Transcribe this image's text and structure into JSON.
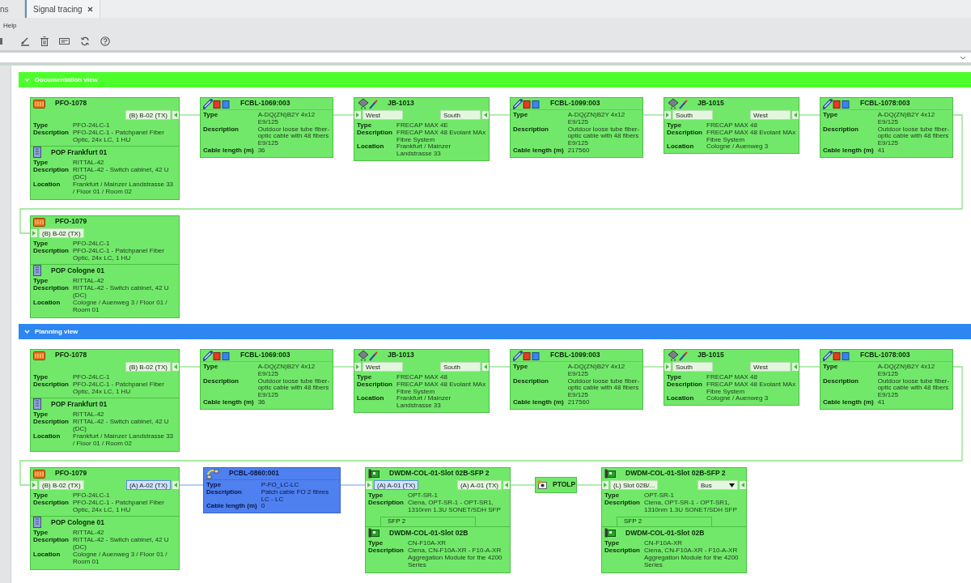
{
  "tabs": [
    {
      "label": "ns",
      "selected": false,
      "closable": false
    },
    {
      "label": "Signal tracing",
      "selected": true,
      "closable": true
    }
  ],
  "menu": [
    "Help"
  ],
  "sections": [
    {
      "title": "Documentation view",
      "color": "#4cff2c",
      "expanded": true,
      "rows": [
        [
          {
            "kind": "panel",
            "title": "PFO-1078",
            "selected": false,
            "ports": [
              {
                "label": "(B) B-02 (TX)",
                "kind": "output",
                "selected": false
              }
            ],
            "fields": [
              {
                "label": "Type",
                "value": "PFO-24LC-1"
              },
              {
                "label": "Description",
                "value": "PFO-24LC-1 - Patchpanel Fiber Optic, 24x LC, 1 HU"
              }
            ],
            "sub": {
              "kind": "cabinet",
              "title": "POP Frankfurt 01",
              "fields": [
                {
                  "label": "Type",
                  "value": "RITTAL-42"
                },
                {
                  "label": "Description",
                  "value": "RITTAL-42 - Switch cabinet, 42 U (DC)"
                },
                {
                  "label": "Location",
                  "value": "Frankfurt / Mainzer Landstrasse 33 / Floor 01 / Room 02"
                }
              ]
            }
          },
          {
            "kind": "cable",
            "title": "FCBL-1069:003",
            "selected": false,
            "fields": [
              {
                "label": "Type",
                "value": "A-DQ(ZN)B2Y 4x12 E9/125"
              },
              {
                "label": "Description",
                "value": "Outdoor loose tube fiber-optic cable with 48 fibers E9/125"
              },
              {
                "label": "Cable length (m)",
                "value": "36"
              }
            ]
          },
          {
            "kind": "junction",
            "title": "JB-1013",
            "selected": false,
            "ports": [
              {
                "label": "West",
                "kind": "input",
                "selected": false
              },
              {
                "label": "South",
                "kind": "output",
                "selected": false
              }
            ],
            "fields": [
              {
                "label": "Type",
                "value": "FRECAP MAX 4E"
              },
              {
                "label": "Description",
                "value": "FRECAP MAX 48 Evolant MAx Fibre System"
              },
              {
                "label": "Location",
                "value": "Frankfurt / Mainzer Landstrasse 33"
              }
            ]
          },
          {
            "kind": "cable",
            "title": "FCBL-1099:003",
            "selected": false,
            "fields": [
              {
                "label": "Type",
                "value": "A-DQ(ZN)B2Y 4x12 E9/125"
              },
              {
                "label": "Description",
                "value": "Outdoor loose tube fiber-optic cable with 48 fibers E9/125"
              },
              {
                "label": "Cable length (m)",
                "value": "217560"
              }
            ]
          },
          {
            "kind": "junction",
            "title": "JB-1015",
            "selected": false,
            "ports": [
              {
                "label": "South",
                "kind": "input",
                "selected": false
              },
              {
                "label": "West",
                "kind": "output",
                "selected": false
              }
            ],
            "fields": [
              {
                "label": "Type",
                "value": "FRECAP MAX 48"
              },
              {
                "label": "Description",
                "value": "FRECAP MAX 48 Evolant MAx Fibre System"
              },
              {
                "label": "Location",
                "value": "Cologne / Auenweg 3"
              }
            ]
          },
          {
            "kind": "cable",
            "title": "FCBL-1078:003",
            "selected": false,
            "fields": [
              {
                "label": "Type",
                "value": "A-DQ(ZN)B2Y 4x12 E9/125"
              },
              {
                "label": "Description",
                "value": "Outdoor loose tube fiber-optic cable with 48 fibers E9/125"
              },
              {
                "label": "Cable length (m)",
                "value": "41"
              }
            ]
          }
        ],
        [
          {
            "kind": "panel",
            "title": "PFO-1079",
            "selected": false,
            "ports": [
              {
                "label": "(B) B-02 (TX)",
                "kind": "input",
                "selected": false
              }
            ],
            "fields": [
              {
                "label": "Type",
                "value": "PFO-24LC-1"
              },
              {
                "label": "Description",
                "value": "PFO-24LC-1 - Patchpanel Fiber Optic, 24x LC, 1 HU"
              }
            ],
            "sub": {
              "kind": "cabinet",
              "title": "POP Cologne 01",
              "fields": [
                {
                  "label": "Type",
                  "value": "RITTAL-42"
                },
                {
                  "label": "Description",
                  "value": "RITTAL-42 - Switch cabinet, 42 U (DC)"
                },
                {
                  "label": "Location",
                  "value": "Cologne / Auenweg 3 / Floor 01 / Room 01"
                }
              ]
            }
          }
        ]
      ]
    },
    {
      "title": "Planning view",
      "color": "#2d86f2",
      "expanded": true,
      "rows": [
        [
          {
            "kind": "panel",
            "title": "PFO-1078",
            "selected": false,
            "ports": [
              {
                "label": "(B) B-02 (TX)",
                "kind": "output",
                "selected": false
              }
            ],
            "fields": [
              {
                "label": "Type",
                "value": "PFO-24LC-1"
              },
              {
                "label": "Description",
                "value": "PFO-24LC-1 - Patchpanel Fiber Optic, 24x LC, 1 HU"
              }
            ],
            "sub": {
              "kind": "cabinet",
              "title": "POP Frankfurt 01",
              "fields": [
                {
                  "label": "Type",
                  "value": "RITTAL-42"
                },
                {
                  "label": "Description",
                  "value": "RITTAL-42 - Switch cabinet, 42 U (DC)"
                },
                {
                  "label": "Location",
                  "value": "Frankfurt / Mainzer Landstrasse 33 / Floor 01 / Room 02"
                }
              ]
            }
          },
          {
            "kind": "cable",
            "title": "FCBL-1069:003",
            "selected": false,
            "fields": [
              {
                "label": "Type",
                "value": "A-DQ(ZN)B2Y 4x12 E9/125"
              },
              {
                "label": "Description",
                "value": "Outdoor loose tube fiber-optic cable with 48 fibers E9/125"
              },
              {
                "label": "Cable length (m)",
                "value": "36"
              }
            ]
          },
          {
            "kind": "junction",
            "title": "JB-1013",
            "selected": false,
            "ports": [
              {
                "label": "West",
                "kind": "input",
                "selected": false
              },
              {
                "label": "South",
                "kind": "output",
                "selected": false
              }
            ],
            "fields": [
              {
                "label": "Type",
                "value": "FRECAP MAX 48"
              },
              {
                "label": "Description",
                "value": "FRECAP MAX 48 Evolant MAx Fibre System"
              },
              {
                "label": "Location",
                "value": "Frankfurt / Mainzer Landstrasse 33"
              }
            ]
          },
          {
            "kind": "cable",
            "title": "FCBL-1099:003",
            "selected": false,
            "fields": [
              {
                "label": "Type",
                "value": "A-DQ(ZN)B2Y 4x12 E9/125"
              },
              {
                "label": "Description",
                "value": "Outdoor loose tube fiber-optic cable with 48 fibers E9/125"
              },
              {
                "label": "Cable length (m)",
                "value": "217560"
              }
            ]
          },
          {
            "kind": "junction",
            "title": "JB-1015",
            "selected": false,
            "ports": [
              {
                "label": "South",
                "kind": "input",
                "selected": false
              },
              {
                "label": "West",
                "kind": "output",
                "selected": false
              }
            ],
            "fields": [
              {
                "label": "Type",
                "value": "FRECAP MAX 48"
              },
              {
                "label": "Description",
                "value": "FRECAP MAX 48 Evolant MAx Fibre System"
              },
              {
                "label": "Location",
                "value": "Cologne / Auenweg 3"
              }
            ]
          },
          {
            "kind": "cable",
            "title": "FCBL-1078:003",
            "selected": false,
            "fields": [
              {
                "label": "Type",
                "value": "A-DQ(ZN)B2Y 4x12 E9/125"
              },
              {
                "label": "Description",
                "value": "Outdoor loose tube fiber-optic cable with 48 fibers E9/125"
              },
              {
                "label": "Cable length (m)",
                "value": "41"
              }
            ]
          }
        ],
        [
          {
            "kind": "panel",
            "title": "PFO-1079",
            "selected": false,
            "ports": [
              {
                "label": "(B) B-02 (TX)",
                "kind": "input",
                "selected": false
              },
              {
                "label": "(A) A-02 (TX)",
                "kind": "output",
                "selected": true
              }
            ],
            "fields": [
              {
                "label": "Type",
                "value": "PFO-24LC-1"
              },
              {
                "label": "Description",
                "value": "PFO-24LC-1 - Patchpanel Fiber Optic, 24x LC, 1 HU"
              }
            ],
            "sub": {
              "kind": "cabinet",
              "title": "POP Cologne 01",
              "fields": [
                {
                  "label": "Type",
                  "value": "RITTAL-42"
                },
                {
                  "label": "Description",
                  "value": "RITTAL-42 - Switch cabinet, 42 U (DC)"
                },
                {
                  "label": "Location",
                  "value": "Cologne / Auenweg 3 / Floor 01 / Room 01"
                }
              ]
            }
          },
          {
            "kind": "patch-cord",
            "title": "PCBL-0860:001",
            "selected": true,
            "fields": [
              {
                "label": "Type",
                "value": "P-FO_LC-LC"
              },
              {
                "label": "Description",
                "value": "Patch cable FO 2 fibres LC - LC"
              },
              {
                "label": "Cable length (m)",
                "value": "0"
              }
            ]
          },
          {
            "kind": "card",
            "title": "DWDM-COL-01-Slot 02B-SFP 2",
            "selected": false,
            "ports": [
              {
                "label": "(A) A-01 (TX)",
                "kind": "input",
                "selected": true
              },
              {
                "label": "(A) A-01 (TX)",
                "kind": "output",
                "selected": false
              }
            ],
            "fields": [
              {
                "label": "Type",
                "value": "OPT-SR-1"
              },
              {
                "label": "Description",
                "value": "Ciena, OPT-SR-1 - OPT-SR1, 1310nm 1.3U SONET/SDH SFP"
              }
            ],
            "sub": {
              "kind": "card",
              "tab": "SFP 2",
              "title": "DWDM-COL-01-Slot 02B",
              "fields": [
                {
                  "label": "Type",
                  "value": "CN-F10A-XR"
                },
                {
                  "label": "Description",
                  "value": "Ciena, CN-F10A-XR - F10-A-XR Aggregation Module for the 4200 Series"
                }
              ]
            }
          },
          {
            "kind": "splitter",
            "title": "PTOLP",
            "selected": false
          },
          {
            "kind": "card",
            "title": "DWDM-COL-01-Slot 02B-SFP 2",
            "selected": false,
            "ports": [
              {
                "label": "(L) Slot 02B/...",
                "kind": "input",
                "selected": false
              },
              {
                "label": "Bus",
                "kind": "selector",
                "selected": false
              }
            ],
            "fields": [
              {
                "label": "Type",
                "value": "OPT-SR-1"
              },
              {
                "label": "Description",
                "value": "Ciena, OPT-SR-1 - OPT-SR1, 1310nm 1.3U SONET/SDH SFP"
              }
            ],
            "sub": {
              "kind": "card",
              "tab": "SFP 2",
              "title": "DWDM-COL-01-Slot 02B",
              "fields": [
                {
                  "label": "Type",
                  "value": "CN-F10A-XR"
                },
                {
                  "label": "Description",
                  "value": "Ciena, CN-F10A-XR - F10-A-XR Aggregation Module for the 4200 Series"
                }
              ]
            }
          }
        ]
      ]
    }
  ]
}
